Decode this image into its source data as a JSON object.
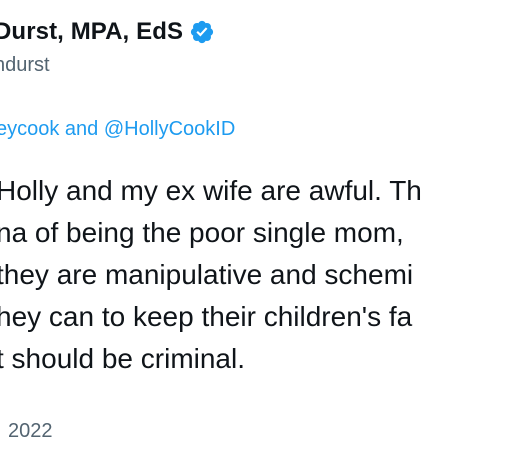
{
  "author": {
    "display_name": "Durst, MPA, EdS",
    "handle": "ndurst"
  },
  "reply": {
    "mention_1": "eycook",
    "connector": " and ",
    "mention_2": "@HollyCookID"
  },
  "body": {
    "lines": [
      "Holly and my ex wife are awful. Th",
      "na of being the poor single mom, ",
      "they are manipulative and schemi",
      "hey can to keep their children's fa",
      "t should be criminal."
    ]
  },
  "timestamp": "2022",
  "colors": {
    "text": "#0f1419",
    "secondary": "#536471",
    "link": "#1d9bf0",
    "verified": "#1d9bf0"
  },
  "icons": {
    "verified": "verified-badge-icon"
  }
}
